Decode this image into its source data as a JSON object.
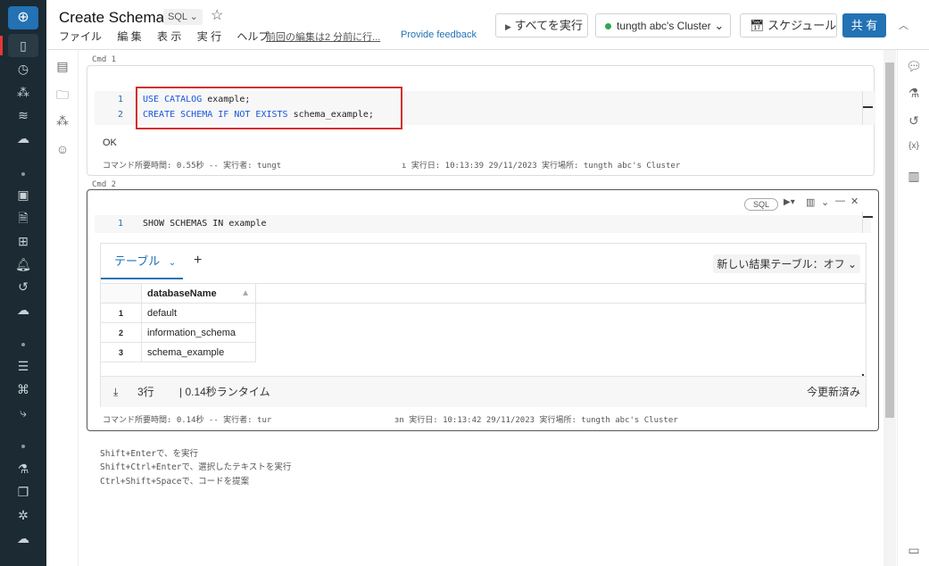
{
  "header": {
    "title": "Create Schema",
    "language": "SQL",
    "menu": [
      "ファイル",
      "編 集",
      "表 示",
      "実 行",
      "ヘルプ"
    ],
    "last_edit": "前回の編集は2 分前に行...",
    "feedback": "Provide feedback",
    "run_all": "すべてを実行",
    "cluster": "tungth abc's Cluster",
    "cluster_status_color": "#2fa84f",
    "schedule": "スケジュール",
    "share": "共 有"
  },
  "cells": [
    {
      "label": "Cmd 1",
      "lines": [
        {
          "n": "1",
          "kw": "USE CATALOG",
          "rest": " example;"
        },
        {
          "n": "2",
          "kw": "CREATE SCHEMA IF NOT EXISTS",
          "rest": " schema_example;"
        }
      ],
      "output": "OK",
      "footer_left": "コマンド所要時間: 0.55秒 -- 実行者: tungt",
      "footer_right": "ı 実行日: 10:13:39 29/11/2023 実行場所: tungth abc's Cluster"
    },
    {
      "label": "Cmd 2",
      "lang_badge": "SQL",
      "lines": [
        {
          "n": "1",
          "kw": "SHOW SCHEMAS IN",
          "rest": " example"
        }
      ],
      "results": {
        "tab": "テーブル",
        "add": "+",
        "new_table_toggle": "新しい結果テーブル：オフ",
        "column": "databaseName",
        "rows": [
          {
            "n": "1",
            "v": "default"
          },
          {
            "n": "2",
            "v": "information_schema"
          },
          {
            "n": "3",
            "v": "schema_example"
          }
        ],
        "row_count": "3行",
        "runtime": "| 0.14秒ランタイム",
        "refreshed": "今更新済み"
      },
      "footer_left": "コマンド所要時間: 0.14秒 -- 実行者: tur",
      "footer_right": "ɜn 実行日: 10:13:42 29/11/2023 実行場所: tungth abc's Cluster"
    }
  ],
  "hints": [
    "Shift+Enterで、を実行",
    "Shift+Ctrl+Enterで、選択したテキストを実行",
    "Ctrl+Shift+Spaceで、コードを提案"
  ],
  "colors": {
    "sidebar": "#1b2a33",
    "accent": "#2272b4",
    "highlight_box": "#d32f2f"
  }
}
